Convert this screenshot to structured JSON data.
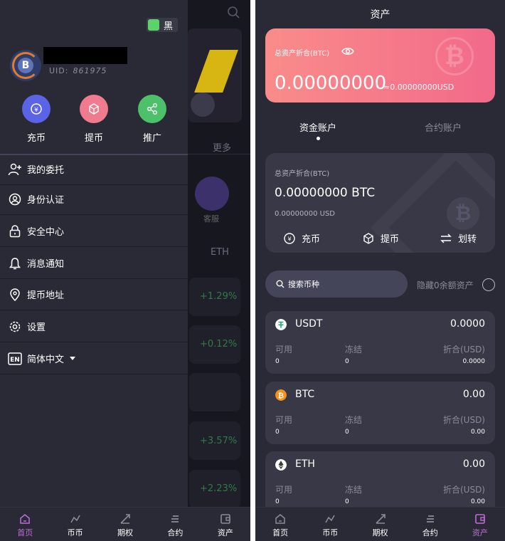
{
  "left": {
    "theme_toggle_label": "黑",
    "uid_label": "UID:",
    "uid_value": "861975",
    "actions": [
      {
        "label": "充币",
        "icon": "deposit-icon",
        "color": "#5b63e6"
      },
      {
        "label": "提币",
        "icon": "withdraw-icon",
        "color": "#f07a8e"
      },
      {
        "label": "推广",
        "icon": "share-icon",
        "color": "#4dc06a"
      }
    ],
    "menu": [
      {
        "label": "我的委托",
        "icon": "user-add-icon"
      },
      {
        "label": "身份认证",
        "icon": "identity-icon"
      },
      {
        "label": "安全中心",
        "icon": "lock-icon"
      },
      {
        "label": "消息通知",
        "icon": "bell-icon"
      },
      {
        "label": "提币地址",
        "icon": "location-pin-icon"
      },
      {
        "label": "设置",
        "icon": "gear-icon"
      },
      {
        "label": "简体中文",
        "icon": "language-en-icon"
      }
    ],
    "background": {
      "more": "更多",
      "service": "客服",
      "eth_header": "ETH",
      "changes": [
        "+1.29%",
        "+0.12%",
        "+3.57%",
        "+2.23%"
      ]
    }
  },
  "tabbar": [
    {
      "label": "首页",
      "icon": "home-icon"
    },
    {
      "label": "币币",
      "icon": "coin-trade-icon"
    },
    {
      "label": "期权",
      "icon": "option-icon"
    },
    {
      "label": "合约",
      "icon": "contract-icon"
    },
    {
      "label": "资产",
      "icon": "wallet-icon"
    }
  ],
  "right": {
    "title": "资产",
    "hero": {
      "label": "总资产折合(BTC)",
      "value": "0.00000000",
      "usd": "≈0.00000000USD"
    },
    "tabs": [
      "资金账户",
      "合约账户"
    ],
    "summary": {
      "label": "总资产折合(BTC)",
      "value": "0.00000000 BTC",
      "usd": "0.00000000 USD",
      "actions": [
        "充币",
        "提币",
        "划转"
      ]
    },
    "search_placeholder": "搜索币种",
    "hide_zero_label": "隐藏0余额资产",
    "col_headers": [
      "可用",
      "冻结",
      "折合(USD)"
    ],
    "coins": [
      {
        "symbol": "USDT",
        "total": "0.0000",
        "available": "0",
        "frozen": "0",
        "usd": "0.0000",
        "color": "#26a17b"
      },
      {
        "symbol": "BTC",
        "total": "0.00",
        "available": "0",
        "frozen": "0",
        "usd": "0.00",
        "color": "#f7931a"
      },
      {
        "symbol": "ETH",
        "total": "0.00",
        "available": "0",
        "frozen": "0",
        "usd": "0.00",
        "color": "#ffffff"
      }
    ]
  },
  "colors": {
    "accent": "#c06cd8",
    "card": "#383846",
    "drawer": "#2a2a36",
    "hero_from": "#f98c8a",
    "hero_to": "#f26a8a"
  }
}
